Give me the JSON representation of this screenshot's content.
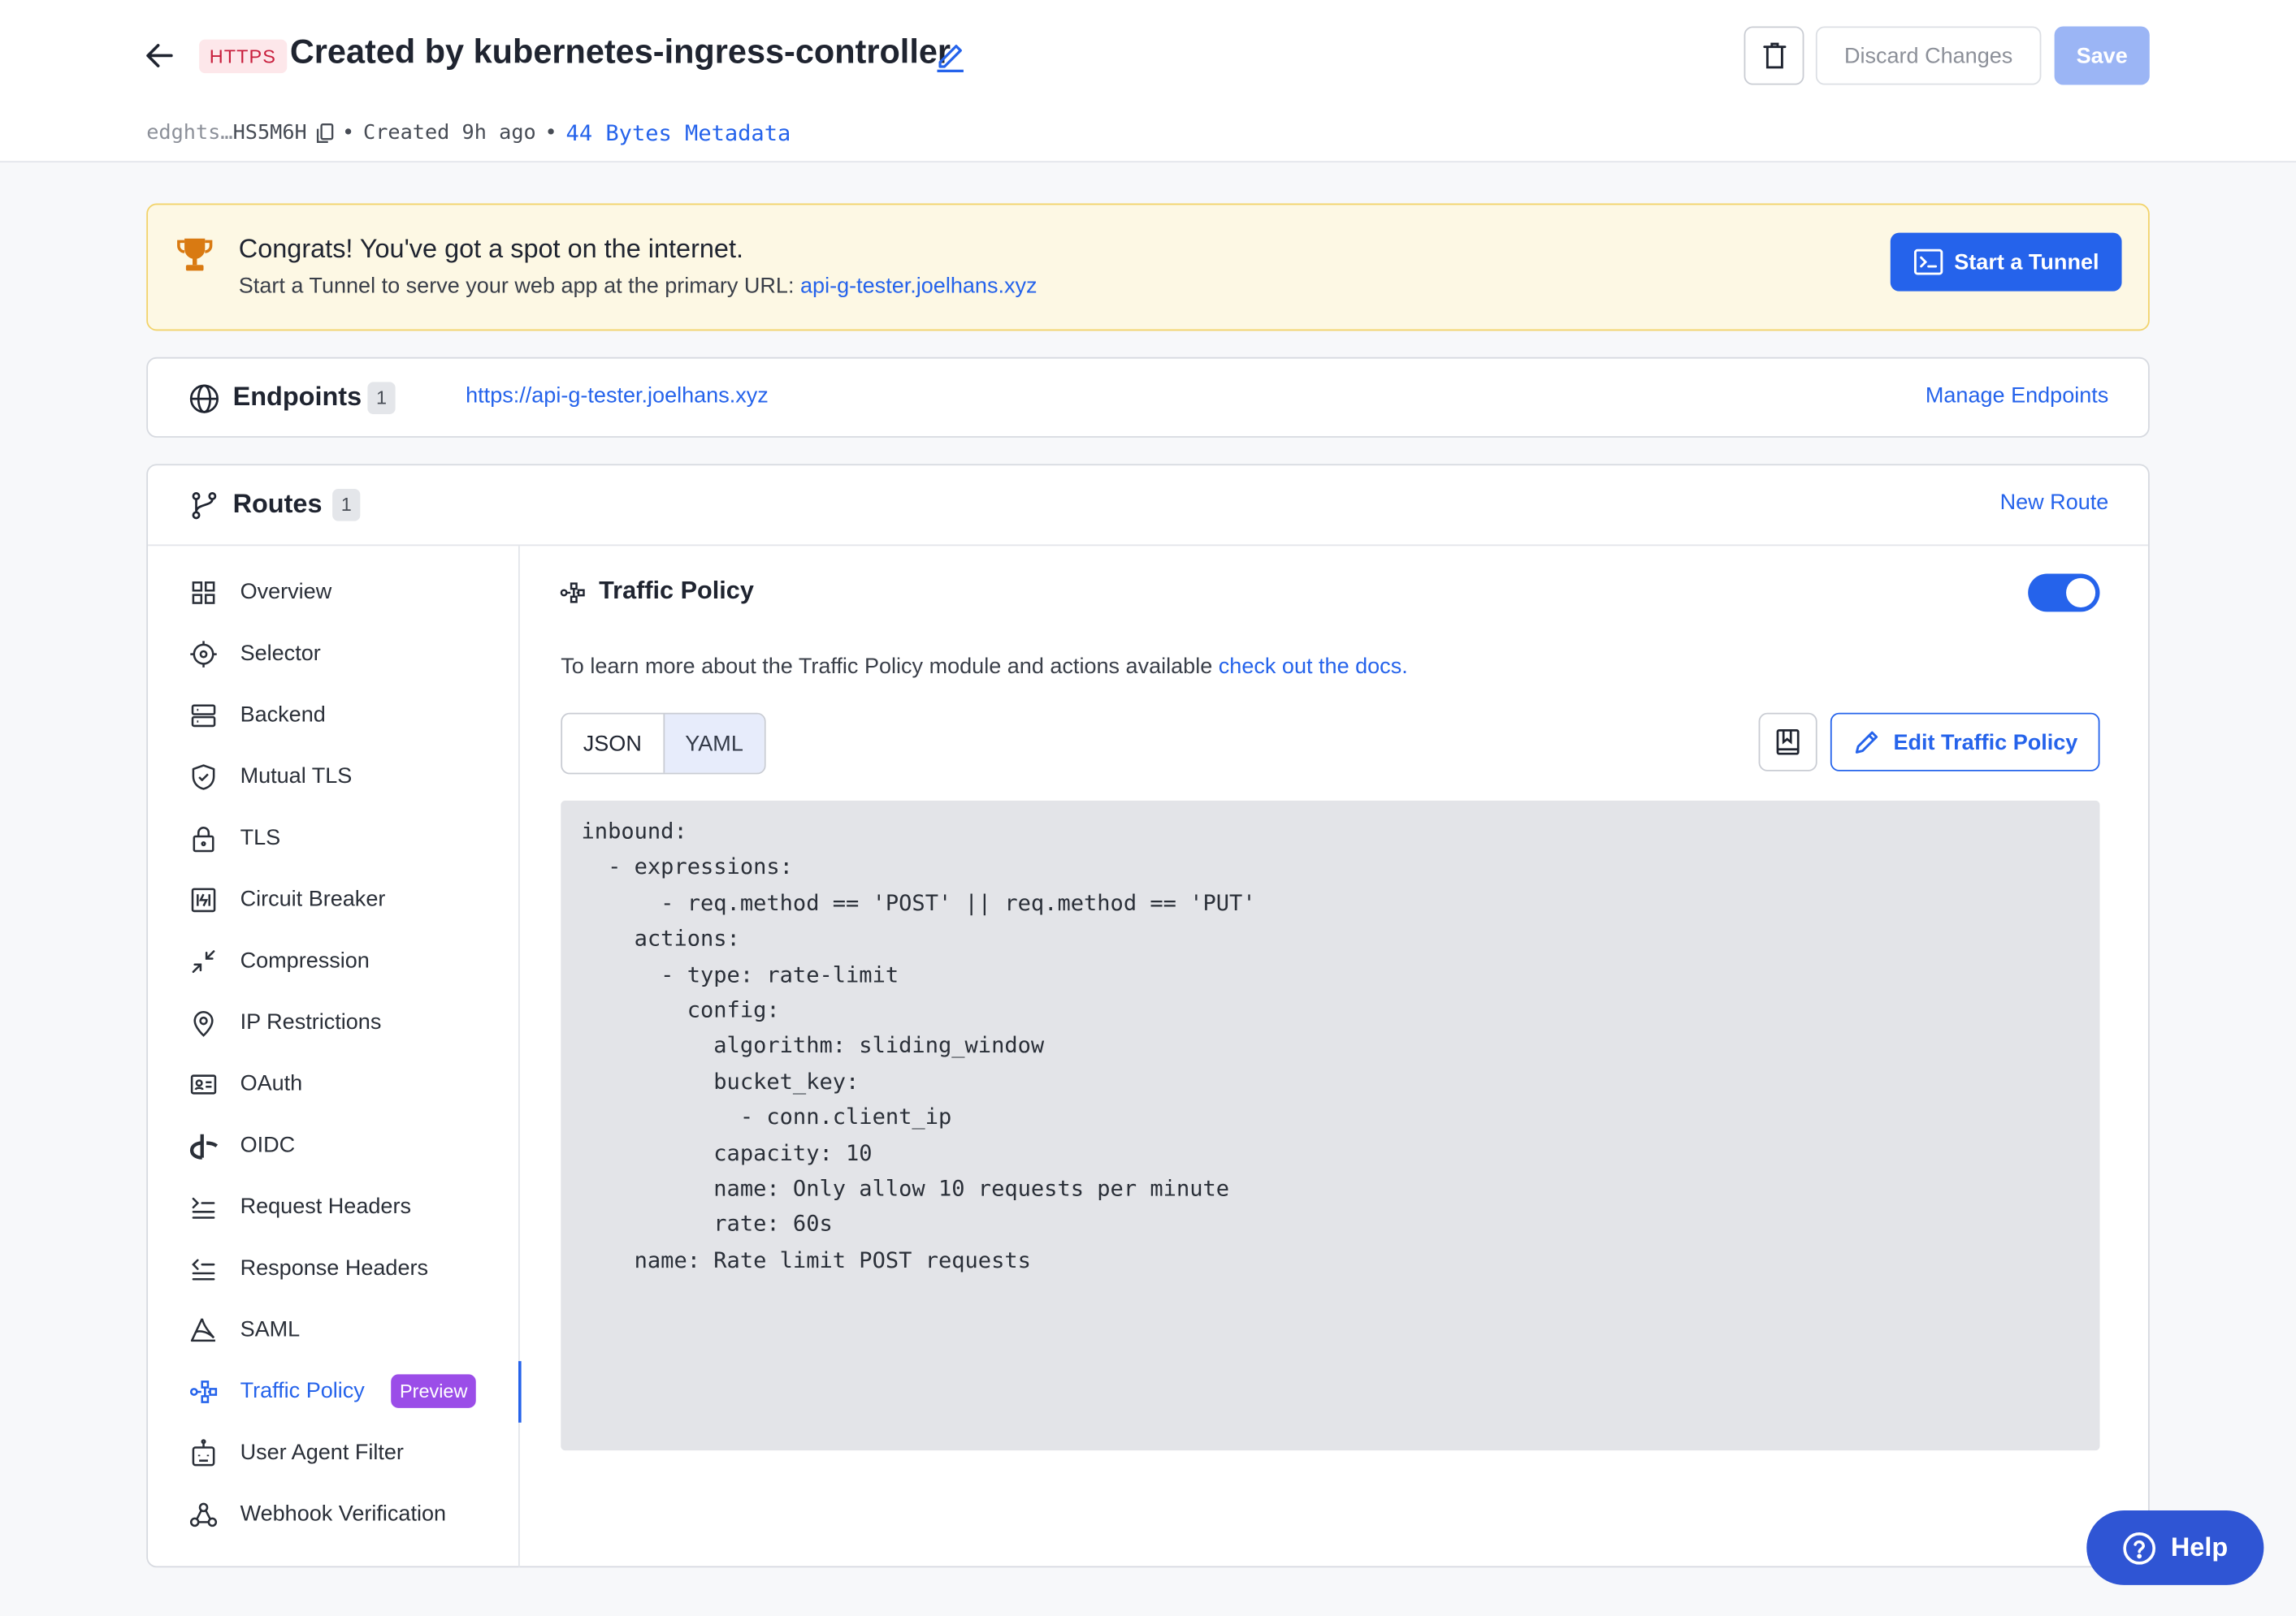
{
  "header": {
    "protocol_badge": "HTTPS",
    "title": "Created by kubernetes-ingress-controller",
    "id_prefix": "edghts…",
    "id_suffix": "HS5M6H",
    "separator": "•",
    "created": "Created 9h ago",
    "metadata_link": "44 Bytes Metadata",
    "discard_label": "Discard Changes",
    "save_label": "Save"
  },
  "banner": {
    "title": "Congrats! You've got a spot on the internet.",
    "text": "Start a Tunnel to serve your web app at the primary URL:",
    "url": "api-g-tester.joelhans.xyz",
    "button_label": "Start a Tunnel"
  },
  "endpoints": {
    "title": "Endpoints",
    "count": "1",
    "url": "https://api-g-tester.joelhans.xyz",
    "manage_label": "Manage Endpoints"
  },
  "routes": {
    "title": "Routes",
    "count": "1",
    "new_label": "New Route",
    "nav": [
      {
        "label": "Overview",
        "icon": "grid-icon"
      },
      {
        "label": "Selector",
        "icon": "target-icon"
      },
      {
        "label": "Backend",
        "icon": "server-icon"
      },
      {
        "label": "Mutual TLS",
        "icon": "shield-check-icon"
      },
      {
        "label": "TLS",
        "icon": "lock-icon"
      },
      {
        "label": "Circuit Breaker",
        "icon": "circuit-icon"
      },
      {
        "label": "Compression",
        "icon": "compress-icon"
      },
      {
        "label": "IP Restrictions",
        "icon": "map-pin-icon"
      },
      {
        "label": "OAuth",
        "icon": "id-card-icon"
      },
      {
        "label": "OIDC",
        "icon": "openid-icon"
      },
      {
        "label": "Request Headers",
        "icon": "request-headers-icon"
      },
      {
        "label": "Response Headers",
        "icon": "response-headers-icon"
      },
      {
        "label": "SAML",
        "icon": "saml-icon"
      },
      {
        "label": "Traffic Policy",
        "icon": "traffic-policy-icon",
        "badge": "Preview",
        "active": true
      },
      {
        "label": "User Agent Filter",
        "icon": "robot-icon"
      },
      {
        "label": "Webhook Verification",
        "icon": "webhook-icon"
      }
    ]
  },
  "traffic_policy": {
    "title": "Traffic Policy",
    "enabled": true,
    "description": "To learn more about the Traffic Policy module and actions available",
    "docs_link": "check out the docs.",
    "formats": [
      "JSON",
      "YAML"
    ],
    "selected_format": "YAML",
    "edit_label": "Edit Traffic Policy",
    "code": "inbound:\n  - expressions:\n      - req.method == 'POST' || req.method == 'PUT'\n    actions:\n      - type: rate-limit\n        config:\n          algorithm: sliding_window\n          bucket_key:\n            - conn.client_ip\n          capacity: 10\n          name: Only allow 10 requests per minute\n          rate: 60s\n    name: Rate limit POST requests"
  },
  "help": {
    "label": "Help"
  },
  "colors": {
    "accent": "#2563eb",
    "https_badge": "#c81e3c",
    "preview_badge": "#9b4de8",
    "banner_bg": "#fdf8e4"
  }
}
